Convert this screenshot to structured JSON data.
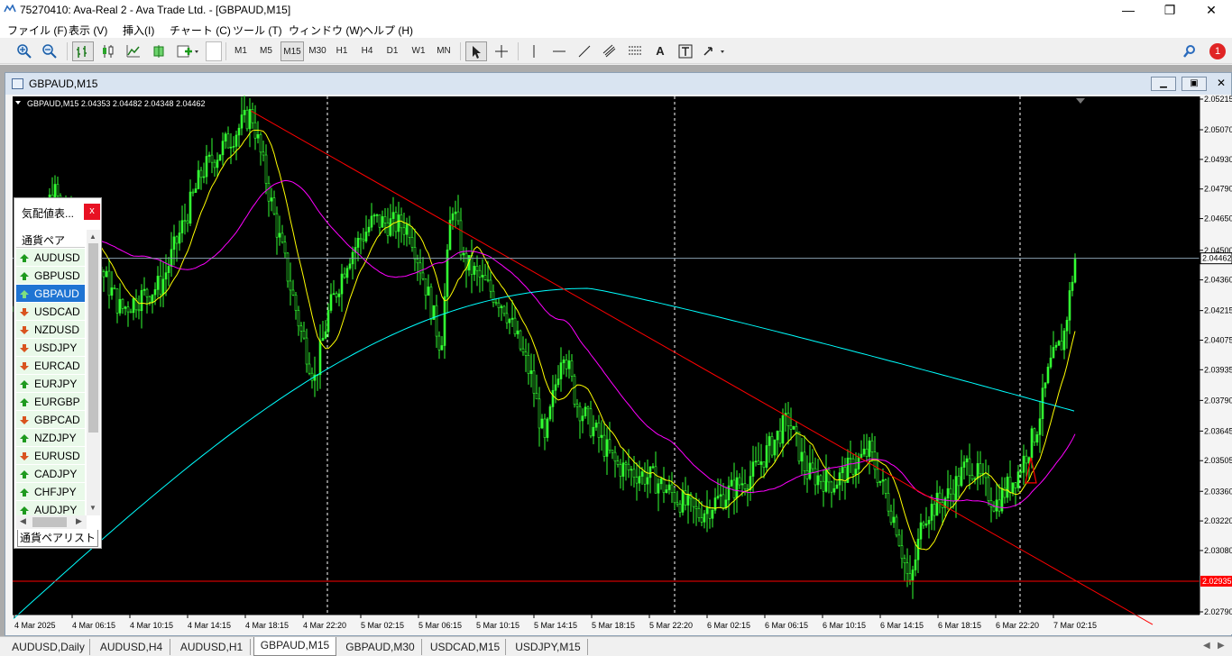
{
  "window": {
    "title": "75270410: Ava-Real 2 - Ava Trade Ltd. - [GBPAUD,M15]",
    "minimize": "—",
    "maximize": "❐",
    "close": "✕"
  },
  "menu": [
    "ファイル (F)",
    "表示 (V)",
    "挿入(I)",
    "チャート (C)",
    "ツール (T)",
    "ウィンドウ (W)",
    "ヘルプ (H)"
  ],
  "toolbar": {
    "timeframes": [
      "M1",
      "M5",
      "M15",
      "M30",
      "H1",
      "H4",
      "D1",
      "W1",
      "MN"
    ],
    "active_timeframe": "M15",
    "text_tool": "A",
    "notification_count": "1"
  },
  "chart_window": {
    "title": "GBPAUD,M15",
    "info": "GBPAUD,M15  2.04353 2.04482 2.04348 2.04462",
    "price_labels": [
      "2.05215",
      "2.05070",
      "2.04930",
      "2.04790",
      "2.04650",
      "2.04500",
      "2.04360",
      "2.04215",
      "2.04075",
      "2.03935",
      "2.03790",
      "2.03645",
      "2.03505",
      "2.03360",
      "2.03220",
      "2.03080",
      "2.02790"
    ],
    "current_price": "2.04462",
    "red_level_label": "2.02935",
    "time_labels": [
      "4 Mar 2025",
      "4 Mar 06:15",
      "4 Mar 10:15",
      "4 Mar 14:15",
      "4 Mar 18:15",
      "4 Mar 22:20",
      "5 Mar 02:15",
      "5 Mar 06:15",
      "5 Mar 10:15",
      "5 Mar 14:15",
      "5 Mar 18:15",
      "5 Mar 22:20",
      "6 Mar 02:15",
      "6 Mar 06:15",
      "6 Mar 10:15",
      "6 Mar 14:15",
      "6 Mar 18:15",
      "6 Mar 22:20",
      "7 Mar 02:15"
    ]
  },
  "market_watch": {
    "title": "気配値表...",
    "close": "x",
    "column_header": "通貨ペア",
    "symbols": [
      {
        "name": "AUDUSD",
        "dir": "up"
      },
      {
        "name": "GBPUSD",
        "dir": "up"
      },
      {
        "name": "GBPAUD",
        "dir": "up",
        "selected": true
      },
      {
        "name": "USDCAD",
        "dir": "down"
      },
      {
        "name": "NZDUSD",
        "dir": "down"
      },
      {
        "name": "USDJPY",
        "dir": "down"
      },
      {
        "name": "EURCAD",
        "dir": "down"
      },
      {
        "name": "EURJPY",
        "dir": "up"
      },
      {
        "name": "EURGBP",
        "dir": "up"
      },
      {
        "name": "GBPCAD",
        "dir": "down"
      },
      {
        "name": "NZDJPY",
        "dir": "up"
      },
      {
        "name": "EURUSD",
        "dir": "down"
      },
      {
        "name": "CADJPY",
        "dir": "up"
      },
      {
        "name": "CHFJPY",
        "dir": "up"
      },
      {
        "name": "AUDJPY",
        "dir": "up"
      }
    ],
    "tab": "通貨ペアリスト"
  },
  "bottom_tabs": [
    "AUDUSD,Daily",
    "AUDUSD,H4",
    "AUDUSD,H1",
    "GBPAUD,M15",
    "GBPAUD,M30",
    "USDCAD,M15",
    "USDJPY,M15"
  ],
  "active_bottom_tab": "GBPAUD,M15",
  "colors": {
    "chart_bg": "#000000",
    "candle": "#32ff32",
    "trendline": "#ff0000",
    "ma_fast": "#ffff00",
    "ma_mid": "#ff00ff",
    "ma_slow": "#00ffff",
    "grid_vertical": "#ffffff",
    "selected_row": "#1f74d3"
  }
}
